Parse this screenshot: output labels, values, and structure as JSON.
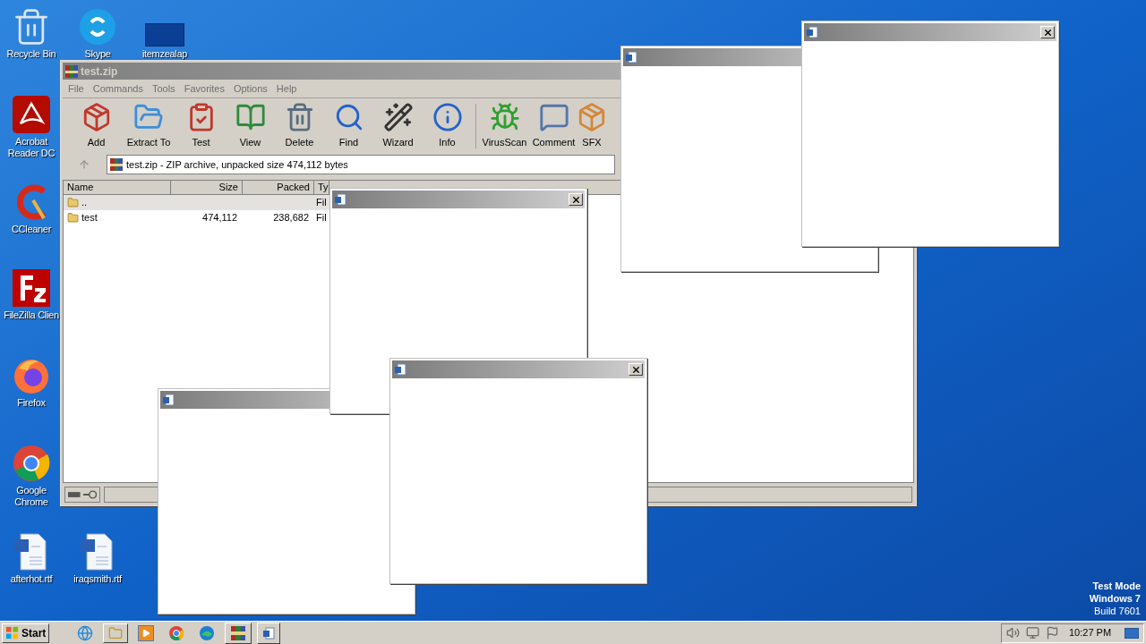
{
  "desktop_icons": [
    {
      "kind": "recycle",
      "label": "Recycle Bin"
    },
    {
      "kind": "skype",
      "label": "Skype"
    },
    {
      "kind": "blank",
      "label": "itemzealap"
    },
    {
      "kind": "acrobat",
      "label": "Acrobat Reader DC"
    },
    {
      "kind": "ccleaner",
      "label": "CCleaner"
    },
    {
      "kind": "filezilla",
      "label": "FileZilla Clien"
    },
    {
      "kind": "firefox",
      "label": "Firefox"
    },
    {
      "kind": "chrome",
      "label": "Google Chrome"
    },
    {
      "kind": "word",
      "label": "afterhot.rtf"
    },
    {
      "kind": "word",
      "label": "iraqsmith.rtf"
    }
  ],
  "system_notice": [
    "Test Mode",
    "Windows 7",
    "Build 7601"
  ],
  "archiver": {
    "title": "test.zip",
    "menu": [
      "File",
      "Commands",
      "Tools",
      "Favorites",
      "Options",
      "Help"
    ],
    "toolbar": [
      {
        "kind": "add",
        "label": "Add"
      },
      {
        "kind": "extract",
        "label": "Extract To"
      },
      {
        "kind": "test",
        "label": "Test"
      },
      {
        "kind": "view",
        "label": "View"
      },
      {
        "kind": "delete",
        "label": "Delete"
      },
      {
        "kind": "find",
        "label": "Find"
      },
      {
        "kind": "wizard",
        "label": "Wizard"
      },
      {
        "kind": "info",
        "label": "Info"
      },
      {
        "kind": "virus",
        "label": "VirusScan"
      },
      {
        "kind": "comment",
        "label": "Comment"
      },
      {
        "kind": "sfx",
        "label": "SFX"
      }
    ],
    "address": "test.zip - ZIP archive, unpacked size 474,112 bytes",
    "columns": [
      "Name",
      "Size",
      "Packed",
      "Ty"
    ],
    "rows": [
      {
        "name": "..",
        "type": "Fil",
        "selected": true
      },
      {
        "name": "test",
        "size": "474,112",
        "packed": "238,682",
        "type": "Fil",
        "selected": false
      }
    ]
  },
  "taskbar": {
    "start": "Start",
    "apps": [
      {
        "kind": "ie"
      },
      {
        "kind": "explorer"
      },
      {
        "kind": "media"
      },
      {
        "kind": "chrome"
      },
      {
        "kind": "edge"
      }
    ],
    "tasks": [
      {
        "kind": "winrar"
      },
      {
        "kind": "word"
      }
    ],
    "clock": "10:27 PM"
  }
}
